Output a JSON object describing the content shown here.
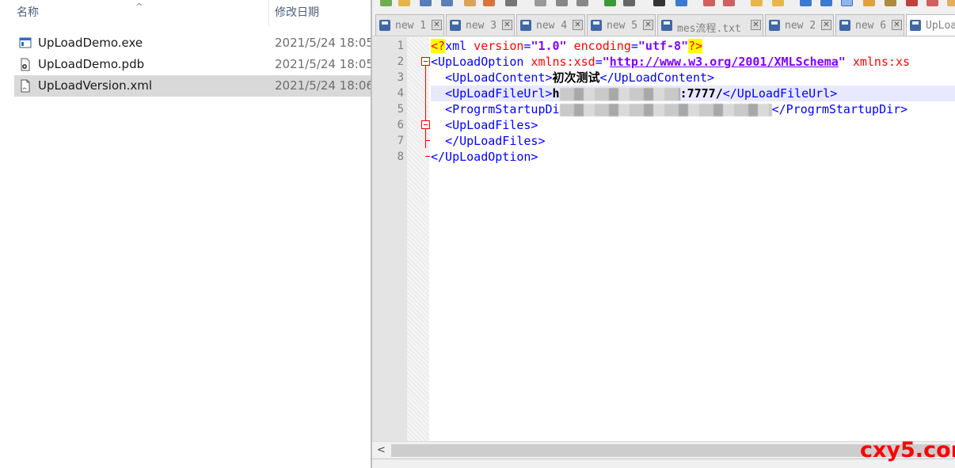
{
  "explorer": {
    "columns": {
      "name": "名称",
      "date": "修改日期",
      "sort_indicator": "^"
    },
    "files": [
      {
        "name": "UpLoadDemo.exe",
        "date": "2021/5/24 18:05",
        "icon": "exe-file-icon"
      },
      {
        "name": "UpLoadDemo.pdb",
        "date": "2021/5/24 18:05",
        "icon": "pdb-file-icon"
      },
      {
        "name": "UpLoadVersion.xml",
        "date": "2021/5/24 18:06",
        "icon": "xml-file-icon",
        "selected": true
      }
    ]
  },
  "editor": {
    "tabs": [
      {
        "label": "new 1"
      },
      {
        "label": "new 3"
      },
      {
        "label": "new 4"
      },
      {
        "label": "new 5"
      },
      {
        "label": "mes流程.txt"
      },
      {
        "label": "new 2"
      },
      {
        "label": "new 6"
      },
      {
        "label": "UpLoa"
      }
    ],
    "tab_close_glyph": "✕",
    "line_numbers": [
      "1",
      "2",
      "3",
      "4",
      "5",
      "6",
      "7",
      "8"
    ],
    "code": {
      "l1": {
        "open": "<?",
        "name": "xml",
        "a1": " version",
        "eq1": "=",
        "v1": "\"1.0\"",
        "a2": " encoding",
        "eq2": "=",
        "v2": "\"utf-8\"",
        "close": "?>"
      },
      "l2": {
        "tag": "<UpLoadOption",
        "a1": " xmlns:xsd",
        "eq1": "=",
        "v1q": "\"",
        "url": "http://www.w3.org/2001/XMLSchema",
        "v1qe": "\"",
        "a2": " xmlns:xs"
      },
      "l3": {
        "indent": "  ",
        "open": "<UpLoadContent>",
        "text": "初次测试",
        "close": "</UpLoadContent>"
      },
      "l4": {
        "indent": "  ",
        "open": "<UpLoadFileUrl>",
        "text_start": "h",
        "text_end": ":7777/",
        "close": "</UpLoadFileUrl>"
      },
      "l5": {
        "indent": "  ",
        "open": "<ProgrmStartupDir>",
        "close": "</ProgrmStartupDir>"
      },
      "l6": {
        "indent": "  ",
        "open": "<UpLoadFiles>"
      },
      "l7": {
        "indent": "  ",
        "close": "</UpLoadFiles>"
      },
      "l8": {
        "close": "</UpLoadOption>"
      }
    },
    "scroll_left_glyph": "<"
  },
  "watermark": "cxy5.com",
  "colors": {
    "tag": "#0000ff",
    "attr": "#ff0000",
    "value": "#8000ff",
    "selection": "#d9d9d9",
    "current_line": "#e8e8ff",
    "watermark": "#ff0000"
  }
}
